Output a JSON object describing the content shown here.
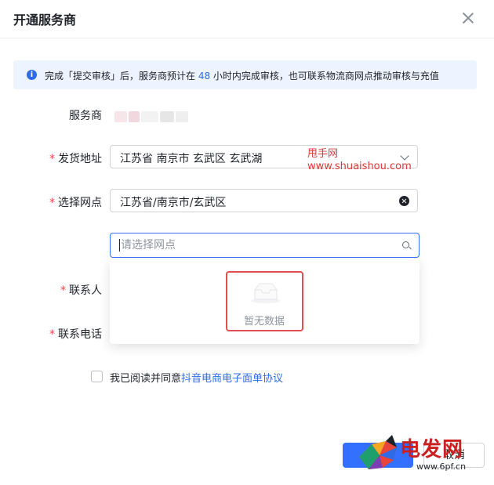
{
  "dialog": {
    "title": "开通服务商"
  },
  "notice": {
    "text_prefix": "完成「提交审核」后，服务商预计在 ",
    "hours": "48",
    "text_suffix": " 小时内完成审核，也可联系物流商网点推动审核与充值"
  },
  "form": {
    "provider_label": "服务商",
    "address_label": "发货地址",
    "address_value": "江苏省 南京市 玄武区 玄武湖",
    "branch_label": "选择网点",
    "branch_value": "江苏省/南京市/玄武区",
    "search_placeholder": "请选择网点",
    "contact_label": "联系人",
    "phone_label": "联系电话",
    "required_mark": "*"
  },
  "dropdown": {
    "empty_text": "暂无数据"
  },
  "agreement": {
    "prefix": "我已阅读并同意",
    "link": "抖音电商电子面单协议"
  },
  "footer": {
    "cancel_label": "取消"
  },
  "watermarks": {
    "site_name": "甩手网",
    "site_url": "www.shuaishou.com",
    "logo_text": "电发网",
    "logo_url": "www.6pf.cn"
  },
  "colors": {
    "primary": "#3370ff",
    "link": "#2e6be6",
    "required": "#f54a45",
    "highlight_border": "#e05050"
  }
}
